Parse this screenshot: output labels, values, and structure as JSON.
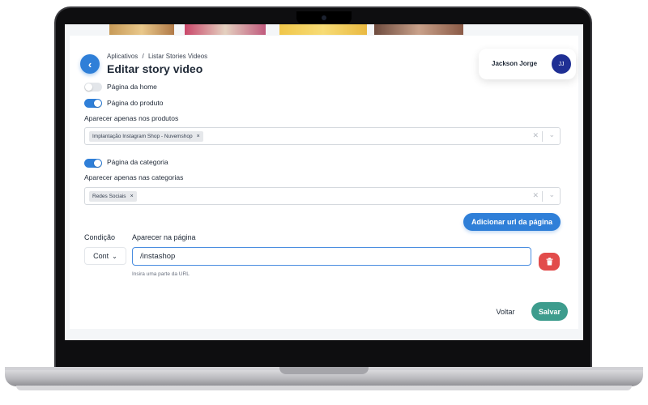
{
  "header": {
    "breadcrumb": {
      "root": "Aplicativos",
      "separator": "/",
      "current": "Listar Stories Videos"
    },
    "title": "Editar story video",
    "back_icon": "‹"
  },
  "user": {
    "name": "Jackson Jorge",
    "initials": "JJ"
  },
  "settings": {
    "home_page": {
      "label": "Página da home",
      "enabled": false
    },
    "product_page": {
      "label": "Página do produto",
      "enabled": true
    },
    "products_filter": {
      "label": "Aparecer apenas nos produtos",
      "selected": [
        "Implantação Instagram Shop - Nuvemshop"
      ]
    },
    "category_page": {
      "label": "Página da categoria",
      "enabled": true
    },
    "categories_filter": {
      "label": "Aparecer apenas nas categorias",
      "selected": [
        "Redes Sociais"
      ]
    }
  },
  "url_rules": {
    "add_button": "Adicionar url da página",
    "condition_label": "Condição",
    "condition_value": "Cont",
    "page_label": "Aparecer na página",
    "page_value": "/instashop",
    "help_text": "Insira uma parte da URL"
  },
  "actions": {
    "back": "Voltar",
    "save": "Salvar"
  },
  "colors": {
    "primary": "#2f7fd8",
    "save": "#3d9c8d",
    "danger": "#e24c4b",
    "avatar": "#1f2f94"
  }
}
